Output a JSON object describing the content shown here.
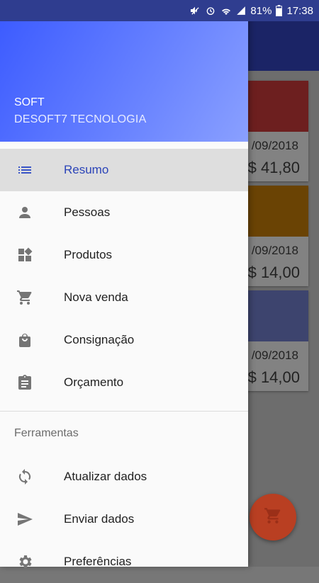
{
  "status_bar": {
    "battery": "81%",
    "time": "17:38"
  },
  "background": {
    "cards": [
      {
        "date": "/09/2018",
        "value": "$ 41,80",
        "color": "#6d1f1f"
      },
      {
        "date": "/09/2018",
        "value": "$ 14,00",
        "color": "#6a4304"
      },
      {
        "date": "/09/2018",
        "value": "$ 14,00",
        "color": "#3d446e"
      }
    ]
  },
  "drawer": {
    "header": {
      "title": "SOFT",
      "subtitle": "DESOFT7 TECNOLOGIA"
    },
    "items": [
      {
        "label": "Resumo",
        "icon": "list-icon",
        "active": true
      },
      {
        "label": "Pessoas",
        "icon": "person-icon"
      },
      {
        "label": "Produtos",
        "icon": "widgets-icon"
      },
      {
        "label": "Nova venda",
        "icon": "cart-icon"
      },
      {
        "label": "Consignação",
        "icon": "bag-icon"
      },
      {
        "label": "Orçamento",
        "icon": "clipboard-icon"
      }
    ],
    "section_label": "Ferramentas",
    "tools": [
      {
        "label": "Atualizar dados",
        "icon": "sync-icon"
      },
      {
        "label": "Enviar dados",
        "icon": "send-icon"
      },
      {
        "label": "Preferências",
        "icon": "settings-icon"
      }
    ]
  },
  "colors": {
    "accent": "#2b44b8",
    "header_start": "#3d5cff",
    "header_end": "#8aa0ff",
    "fab": "#b93f22",
    "statusbar": "#2f3d8f"
  }
}
